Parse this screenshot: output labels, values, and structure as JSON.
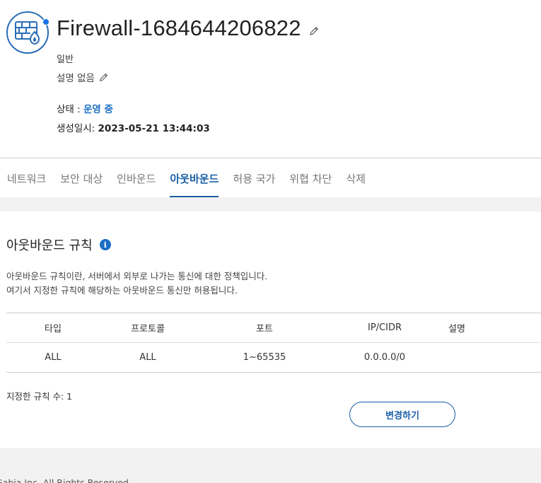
{
  "header": {
    "title": "Firewall-1684644206822",
    "type_label": "일반",
    "description": "설명 없음",
    "status_label": "상태 : ",
    "status_value": "운영 중",
    "created_label": "생성일시: ",
    "created_value": "2023-05-21 13:44:03",
    "icon": "firewall-icon",
    "accent_color": "#1a5fa8"
  },
  "tabs": [
    {
      "label": "네트워크"
    },
    {
      "label": "보안 대상"
    },
    {
      "label": "인바운드"
    },
    {
      "label": "아웃바운드",
      "active": true
    },
    {
      "label": "허용 국가"
    },
    {
      "label": "위협 차단"
    },
    {
      "label": "삭제"
    }
  ],
  "section": {
    "title": "아웃바운드 규칙",
    "info_glyph": "i",
    "desc_line1": "아웃바운드 규칙이란, 서버에서 외부로 나가는 통신에 대한 정책입니다.",
    "desc_line2": "여기서 지정한 규칙에 해당하는 아웃바운드 통신만 허용됩니다."
  },
  "table": {
    "columns": [
      "타입",
      "프로토콜",
      "포트",
      "IP/CIDR",
      "설명"
    ],
    "rows": [
      [
        "ALL",
        "ALL",
        "1~65535",
        "0.0.0.0/0",
        ""
      ]
    ]
  },
  "rule_count_text": "지정한 규칙 수: 1",
  "change_button_label": "변경하기",
  "footer": {
    "copyright": "Gabia Inc. All Rights Reserved."
  }
}
